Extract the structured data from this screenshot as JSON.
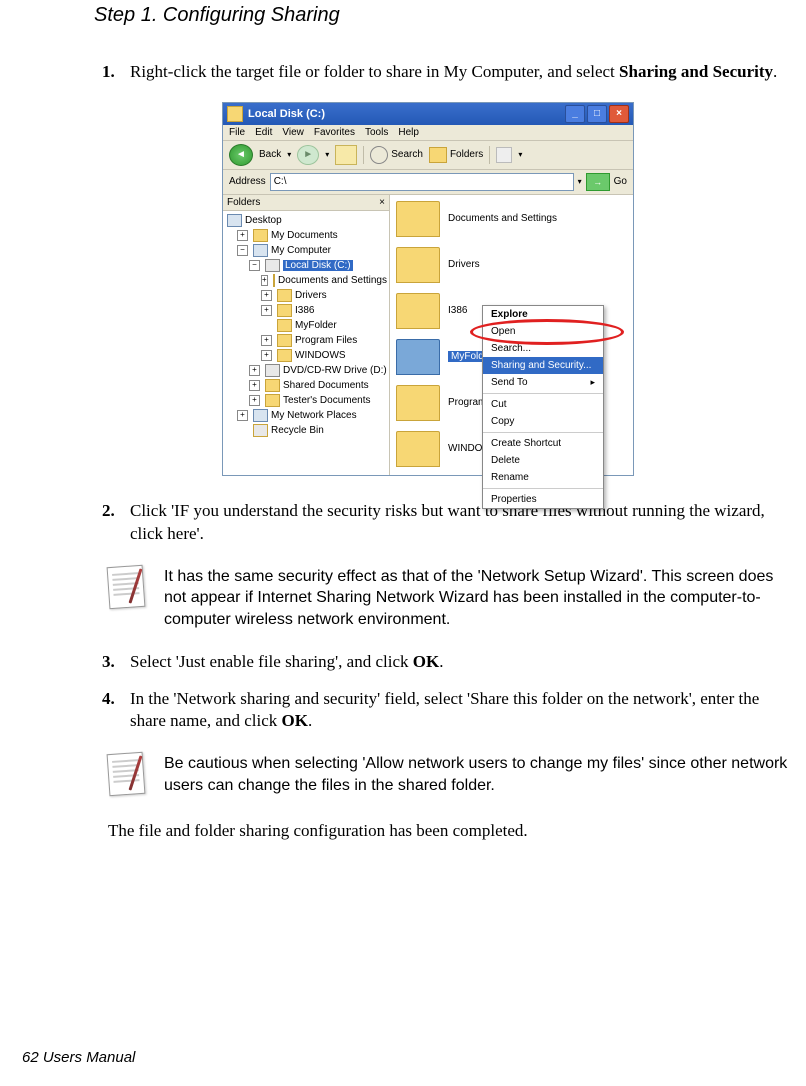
{
  "title": "Step 1. Configuring Sharing",
  "steps": {
    "s1": {
      "num": "1.",
      "text_a": "Right-click the target file or folder to share in My Computer, and select ",
      "bold": "Sharing and Security",
      "text_b": "."
    },
    "s2": {
      "num": "2.",
      "text": "Click 'IF you understand the security risks but want to share files without running the wizard, click here'."
    },
    "s3": {
      "num": "3.",
      "text_a": "Select 'Just enable file sharing', and click ",
      "bold": "OK",
      "text_b": "."
    },
    "s4": {
      "num": "4.",
      "text_a": "In the 'Network sharing and security' field, select 'Share this folder on the network', enter the share name, and click ",
      "bold": "OK",
      "text_b": "."
    }
  },
  "notes": {
    "n1": "It has the same security effect as that of the 'Network Setup Wizard'. This screen does not appear if Internet Sharing Network Wizard has been installed in the computer-to-computer wireless network environment.",
    "n2": "Be cautious when selecting 'Allow network users to change my files' since other network users can change the files in the shared folder."
  },
  "closing": "The file and folder sharing configuration has been completed.",
  "footer": "62  Users Manual",
  "screenshot": {
    "title": "Local Disk (C:)",
    "menu": [
      "File",
      "Edit",
      "View",
      "Favorites",
      "Tools",
      "Help"
    ],
    "toolbar": {
      "back": "Back",
      "search": "Search",
      "folders": "Folders"
    },
    "address_label": "Address",
    "address_value": "C:\\",
    "go": "Go",
    "tree_header": "Folders",
    "tree": {
      "desktop": "Desktop",
      "mydocs": "My Documents",
      "mycomp": "My Computer",
      "localdisk": "Local Disk (C:)",
      "docset": "Documents and Settings",
      "drivers": "Drivers",
      "i386": "I386",
      "myfolder": "MyFolder",
      "progfiles": "Program Files",
      "windows": "WINDOWS",
      "dvd": "DVD/CD-RW Drive (D:)",
      "shared": "Shared Documents",
      "tester": "Tester's Documents",
      "netplaces": "My Network Places",
      "recycle": "Recycle Bin"
    },
    "folders": {
      "f1": "Documents and Settings",
      "f2": "Drivers",
      "f3": "I386",
      "f4": "MyFolder",
      "f5": "Program Files",
      "f6": "WINDOWS"
    },
    "context_menu": {
      "explore": "Explore",
      "open": "Open",
      "search": "Search...",
      "sharing": "Sharing and Security...",
      "sendto": "Send To",
      "cut": "Cut",
      "copy": "Copy",
      "shortcut": "Create Shortcut",
      "delete": "Delete",
      "rename": "Rename",
      "properties": "Properties"
    }
  }
}
